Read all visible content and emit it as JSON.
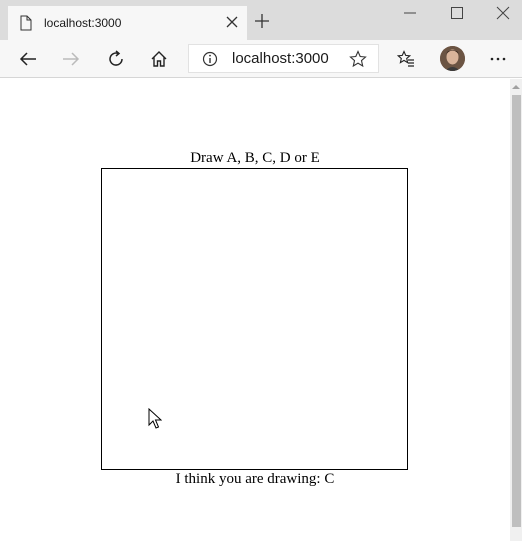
{
  "browser": {
    "tab": {
      "title": "localhost:3000",
      "icon": "page-icon"
    },
    "address": {
      "url": "localhost:3000",
      "info_icon": "info-icon",
      "star_icon": "star-icon"
    },
    "toolbar_icons": [
      "back-icon",
      "forward-icon",
      "refresh-icon",
      "home-icon",
      "favorites-icon",
      "avatar",
      "more-icon"
    ],
    "window_controls": [
      "minimize-icon",
      "maximize-icon",
      "close-icon"
    ]
  },
  "page": {
    "heading": "Draw A, B, C, D or E",
    "result_prefix": "I think you are drawing: ",
    "result_value": "C"
  }
}
